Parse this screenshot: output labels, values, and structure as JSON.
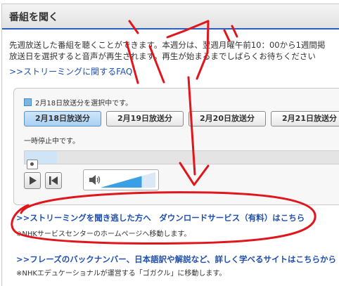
{
  "header": {
    "title": "番組を聞く"
  },
  "intro": {
    "line1": "先週放送した番組を聴くことができます。本週分は、翌週月曜午前10：00から1週間掲",
    "line2": "放送日を選択すると音声が再生されます。再生が始まるまでしばらくお待ちください"
  },
  "faq_link": ">>ストリーミングに関するFAQ",
  "player": {
    "selected_text": "2月18日放送分を選択中です。",
    "tabs": [
      {
        "label": "2月18日放送分",
        "active": true
      },
      {
        "label": "2月19日放送分",
        "active": false
      },
      {
        "label": "2月20日放送分",
        "active": false
      },
      {
        "label": "2月21日放送分",
        "active": false
      }
    ],
    "status": "一時停止中です。",
    "seek_progress": 0.1,
    "volume_level": 0.75
  },
  "download": {
    "link": ">>ストリーミングを聞き逃した方へ　ダウンロードサービス（有料）はこちら",
    "note": "※NHKサービスセンターのホームページへ移動します。"
  },
  "phrases": {
    "link": ">>フレーズのバックナンバー、日本語訳や解説など、詳しく学べるサイトはこちらから",
    "note": "※NHKエデュケーショナルが運営する「ゴガクル」に移動します。"
  },
  "colors": {
    "link": "#1f4fb0",
    "annotation": "#e0161c",
    "accent": "#2a60c0"
  }
}
